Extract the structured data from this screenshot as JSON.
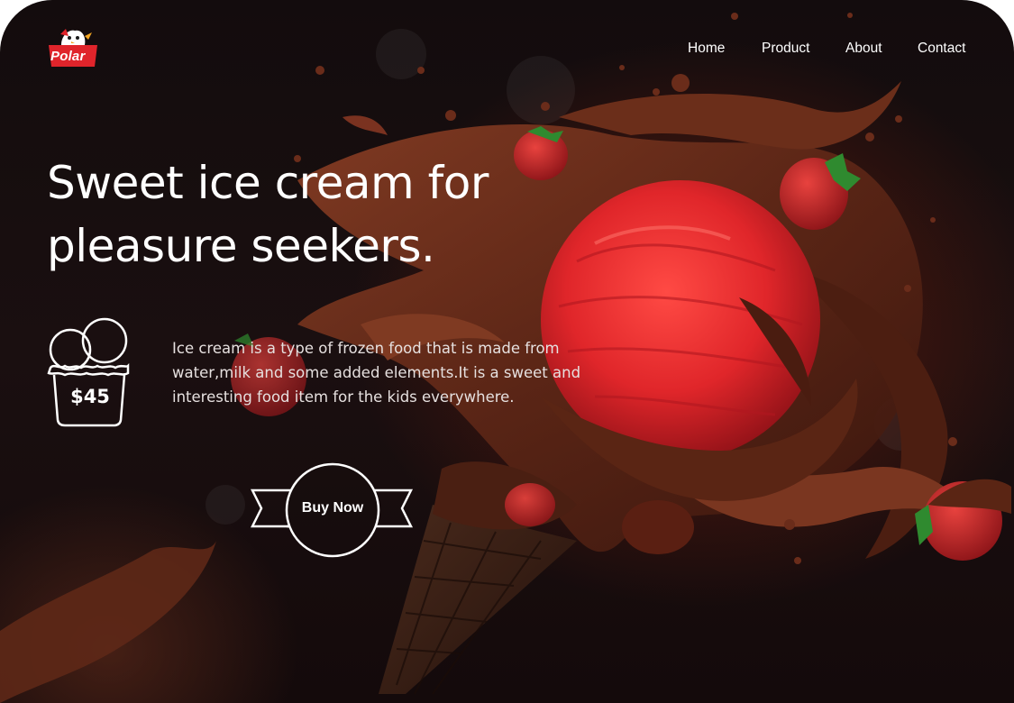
{
  "brand": {
    "name": "Polar",
    "logo_color": "#e0242b"
  },
  "nav": {
    "items": [
      {
        "label": "Home"
      },
      {
        "label": "Product"
      },
      {
        "label": "About"
      },
      {
        "label": "Contact"
      }
    ]
  },
  "hero": {
    "headline_line1": "Sweet ice cream for",
    "headline_line2": "pleasure seekers.",
    "description_lines": [
      "Ice cream is a type of frozen food that is made from",
      "water,milk and some added elements.It is a sweet and",
      "interesting food item for the kids everywhere."
    ],
    "price": "$45",
    "cta_label": "Buy Now"
  },
  "theme": {
    "background": "#140b0c",
    "chocolate": "#6a2e1c",
    "scoop": "#e0262a",
    "strawberry": "#c8232b",
    "leaf": "#2f8a2f",
    "text": "#ffffff"
  },
  "icons": [
    "ice-cream-cup-icon",
    "ribbon-badge-icon",
    "polar-logo-icon"
  ]
}
